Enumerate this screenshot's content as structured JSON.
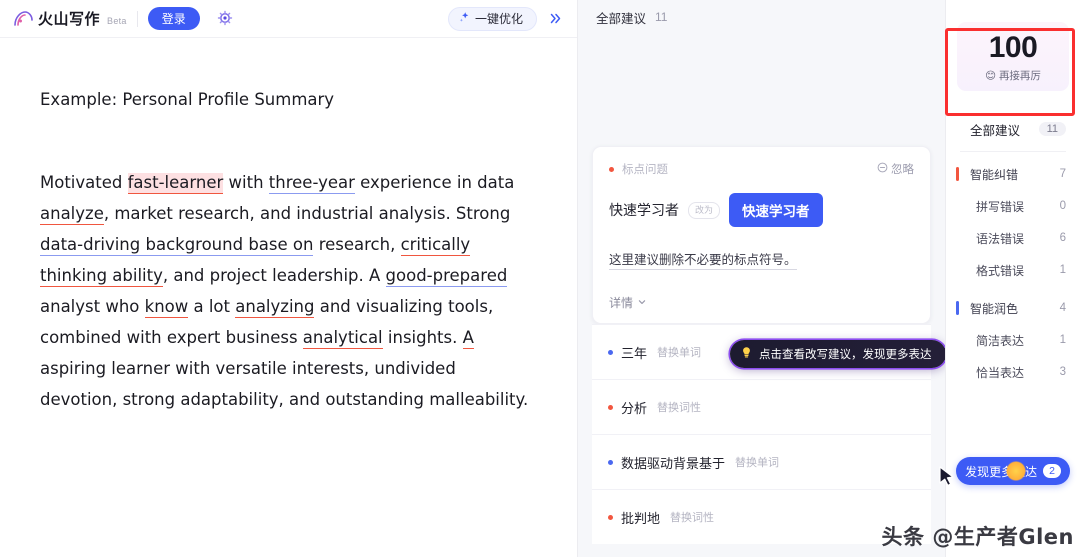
{
  "header": {
    "brand_name": "火山写作",
    "beta_tag": "Beta",
    "login_label": "登录",
    "wand_icon": "magic-wand-icon",
    "optimize_label": "一键优化",
    "optimize_icon": "sparkle-icon",
    "collapse_icon": "chevron-double-right-icon"
  },
  "document": {
    "title": "Example: Personal Profile Summary",
    "paragraph": [
      {
        "text": "Motivated ",
        "mark": "none"
      },
      {
        "text": "fast-learner",
        "mark": "highlight-red"
      },
      {
        "text": " with ",
        "mark": "none"
      },
      {
        "text": "three-year",
        "mark": "underline-blue"
      },
      {
        "text": " experience in data ",
        "mark": "none"
      },
      {
        "text": "analyze",
        "mark": "underline-red"
      },
      {
        "text": ", market research, and industrial analysis. Strong ",
        "mark": "none"
      },
      {
        "text": "data-driving background base on",
        "mark": "underline-blue"
      },
      {
        "text": " research, ",
        "mark": "none"
      },
      {
        "text": "critically thinking ability",
        "mark": "underline-red"
      },
      {
        "text": ", and project leadership. A ",
        "mark": "none"
      },
      {
        "text": "good-prepared",
        "mark": "underline-blue"
      },
      {
        "text": " analyst who ",
        "mark": "none"
      },
      {
        "text": "know",
        "mark": "underline-red"
      },
      {
        "text": " a lot ",
        "mark": "none"
      },
      {
        "text": "analyzing",
        "mark": "underline-red"
      },
      {
        "text": " and visualizing tools, combined with expert business ",
        "mark": "none"
      },
      {
        "text": "analytical",
        "mark": "underline-red"
      },
      {
        "text": " insights. ",
        "mark": "none"
      },
      {
        "text": "A",
        "mark": "underline-red"
      },
      {
        "text": " aspiring learner with versatile interests, undivided devotion, strong adaptability, and outstanding malleability.",
        "mark": "none"
      }
    ]
  },
  "suggestions_panel": {
    "title": "全部建议",
    "count": "11",
    "card": {
      "category": "标点问题",
      "category_dot_color": "#f2563f",
      "ignore_label": "忽略",
      "ignore_icon": "circle-minus-icon",
      "original_word": "快速学习者",
      "change_pill": "改为",
      "replacement_word": "快速学习者",
      "note": "这里建议删除不必要的标点符号。",
      "detail_label": "详情",
      "detail_icon": "chevron-down-icon"
    },
    "items": [
      {
        "word": "三年",
        "action": "替换单词",
        "dot": "#4a68f0"
      },
      {
        "word": "分析",
        "action": "替换词性",
        "dot": "#f2563f"
      },
      {
        "word": "数据驱动背景基于",
        "action": "替换单词",
        "dot": "#4a68f0"
      },
      {
        "word": "批判地",
        "action": "替换词性",
        "dot": "#f2563f"
      }
    ],
    "tooltip": {
      "icon": "lightbulb-icon",
      "text": "点击查看改写建议，发现更多表达"
    }
  },
  "sidebar": {
    "score": "100",
    "score_label": "再接再厉",
    "score_emoji": "😊",
    "all_row": {
      "label": "全部建议",
      "count": "11"
    },
    "groups": [
      {
        "label": "智能纠错",
        "count": "7",
        "bar_color": "#f2563f",
        "children": [
          {
            "label": "拼写错误",
            "count": "0"
          },
          {
            "label": "语法错误",
            "count": "6"
          },
          {
            "label": "格式错误",
            "count": "1"
          }
        ]
      },
      {
        "label": "智能润色",
        "count": "4",
        "bar_color": "#4a68f0",
        "children": [
          {
            "label": "简洁表达",
            "count": "1"
          },
          {
            "label": "恰当表达",
            "count": "3"
          }
        ]
      }
    ],
    "discover": {
      "label": "发现更多表达",
      "badge": "2"
    }
  },
  "watermark": "头条 @生产者Glen",
  "colors": {
    "accent_blue": "#3d5bf5",
    "error_red": "#f2563f",
    "polish_blue": "#4a68f0",
    "highlight_box": "#fa2f2f"
  }
}
